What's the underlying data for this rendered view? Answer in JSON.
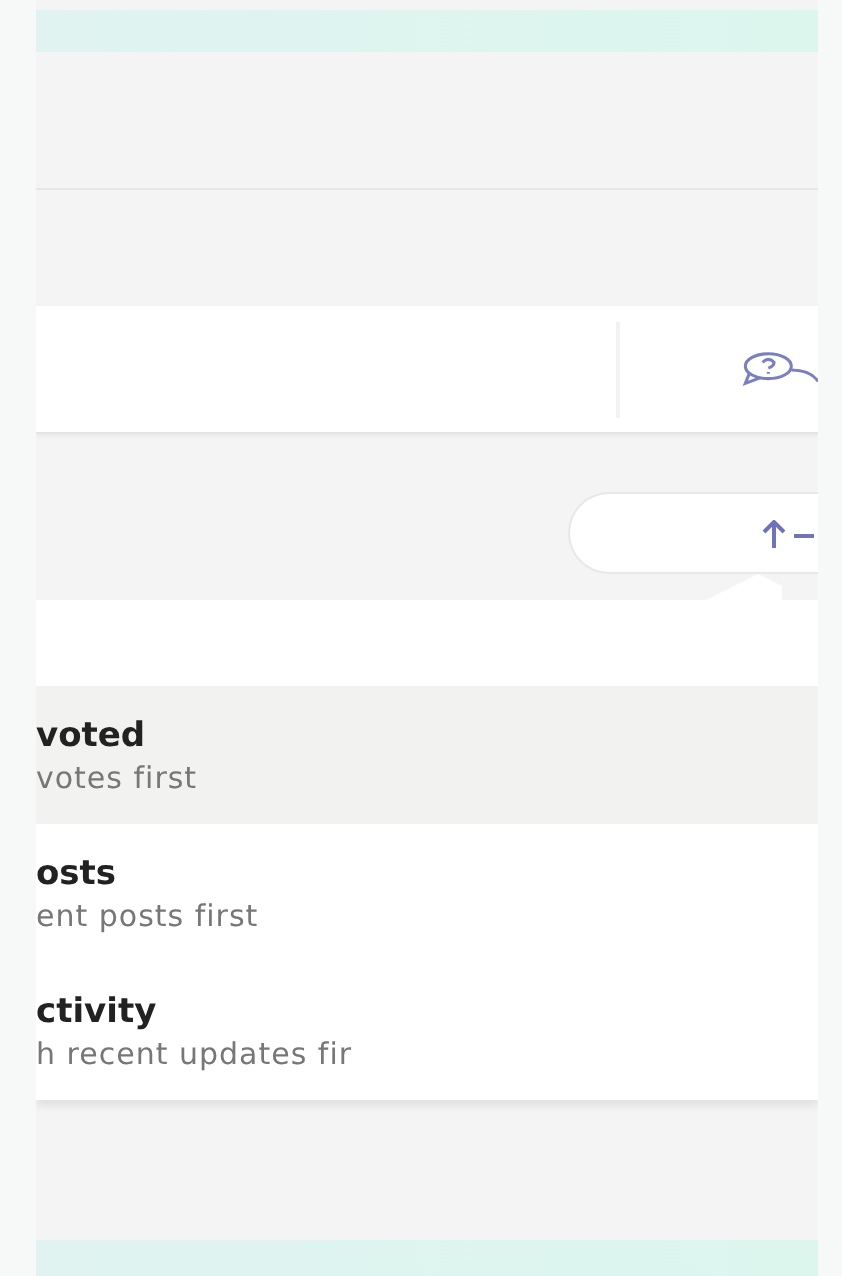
{
  "sort_menu": {
    "options": [
      {
        "title": "voted",
        "description": "votes first",
        "selected": true
      },
      {
        "title": "osts",
        "description": "ent posts first",
        "selected": false
      },
      {
        "title": "ctivity",
        "description": "h recent updates fir",
        "selected": false
      }
    ]
  }
}
